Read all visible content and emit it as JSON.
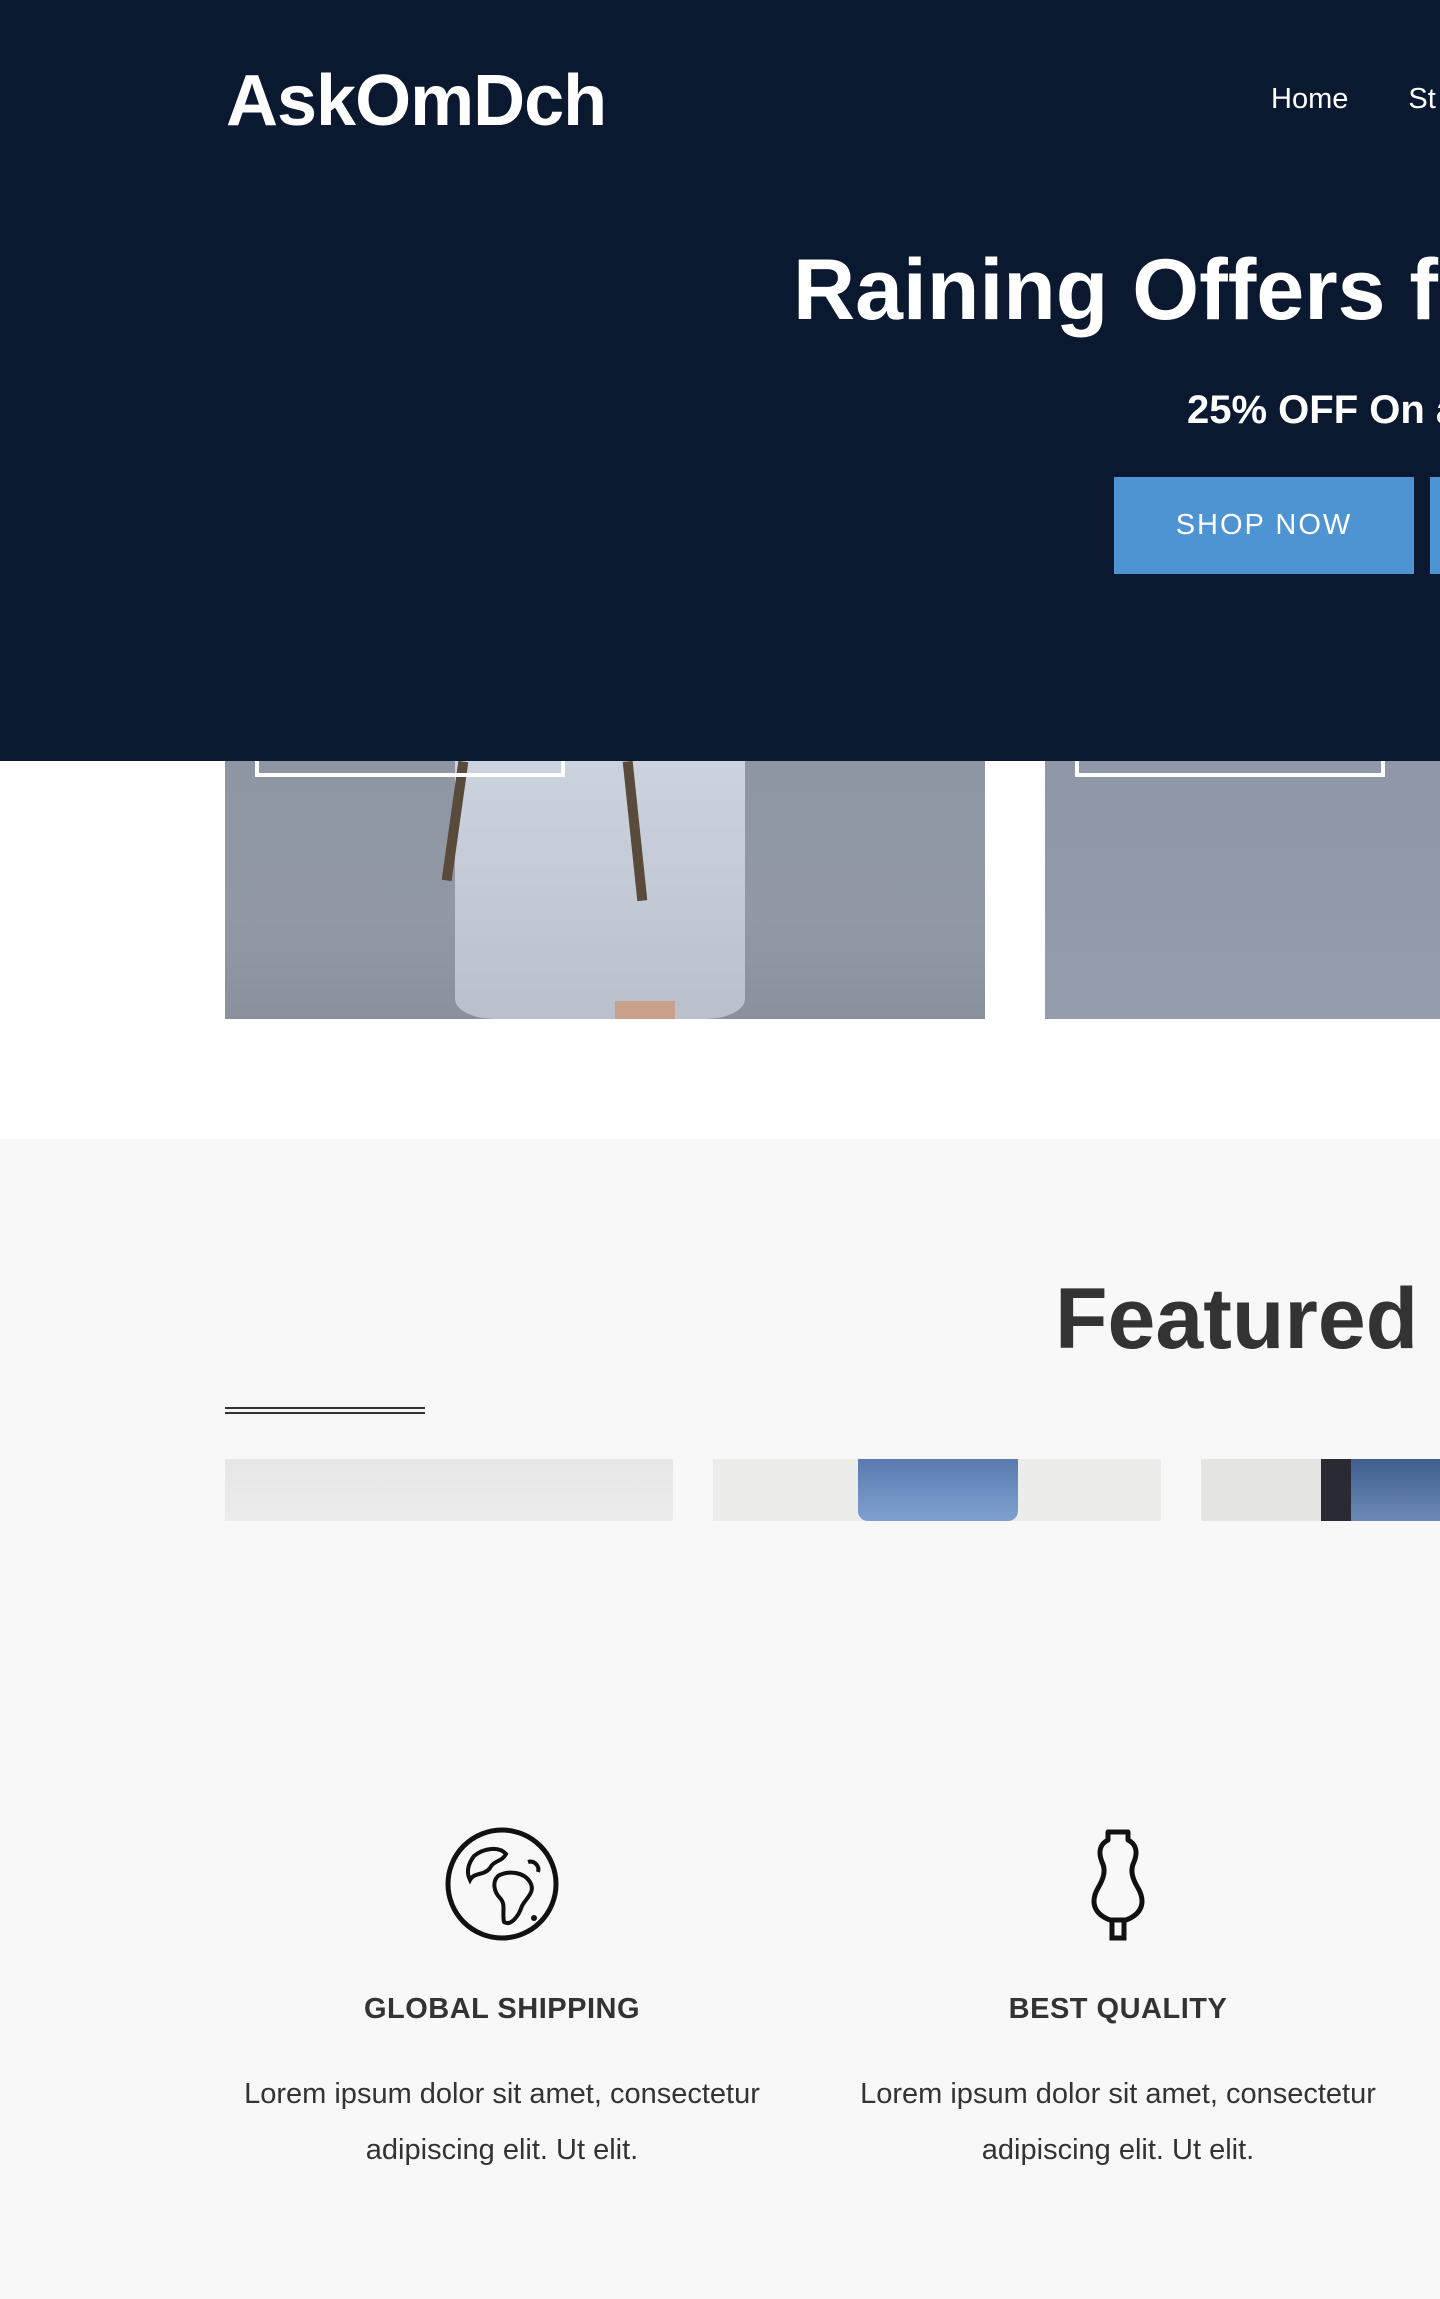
{
  "header": {
    "logo": "AskOmDch",
    "nav": [
      "Home",
      "St"
    ]
  },
  "hero": {
    "title": "Raining Offers fo",
    "subtitle": "25% OFF On a",
    "cta_label": "SHOP NOW"
  },
  "featured": {
    "title": "Featured P"
  },
  "features": [
    {
      "icon": "globe-icon",
      "title": "GLOBAL SHIPPING",
      "text": "Lorem ipsum dolor sit amet, consectetur adipiscing elit. Ut elit."
    },
    {
      "icon": "mannequin-icon",
      "title": "BEST QUALITY",
      "text": "Lorem ipsum dolor sit amet, consectetur adipiscing elit. Ut elit."
    }
  ],
  "colors": {
    "hero_bg": "#0a192f",
    "accent": "#4e94d3",
    "section_bg": "#f8f8f8",
    "text": "#333333"
  }
}
